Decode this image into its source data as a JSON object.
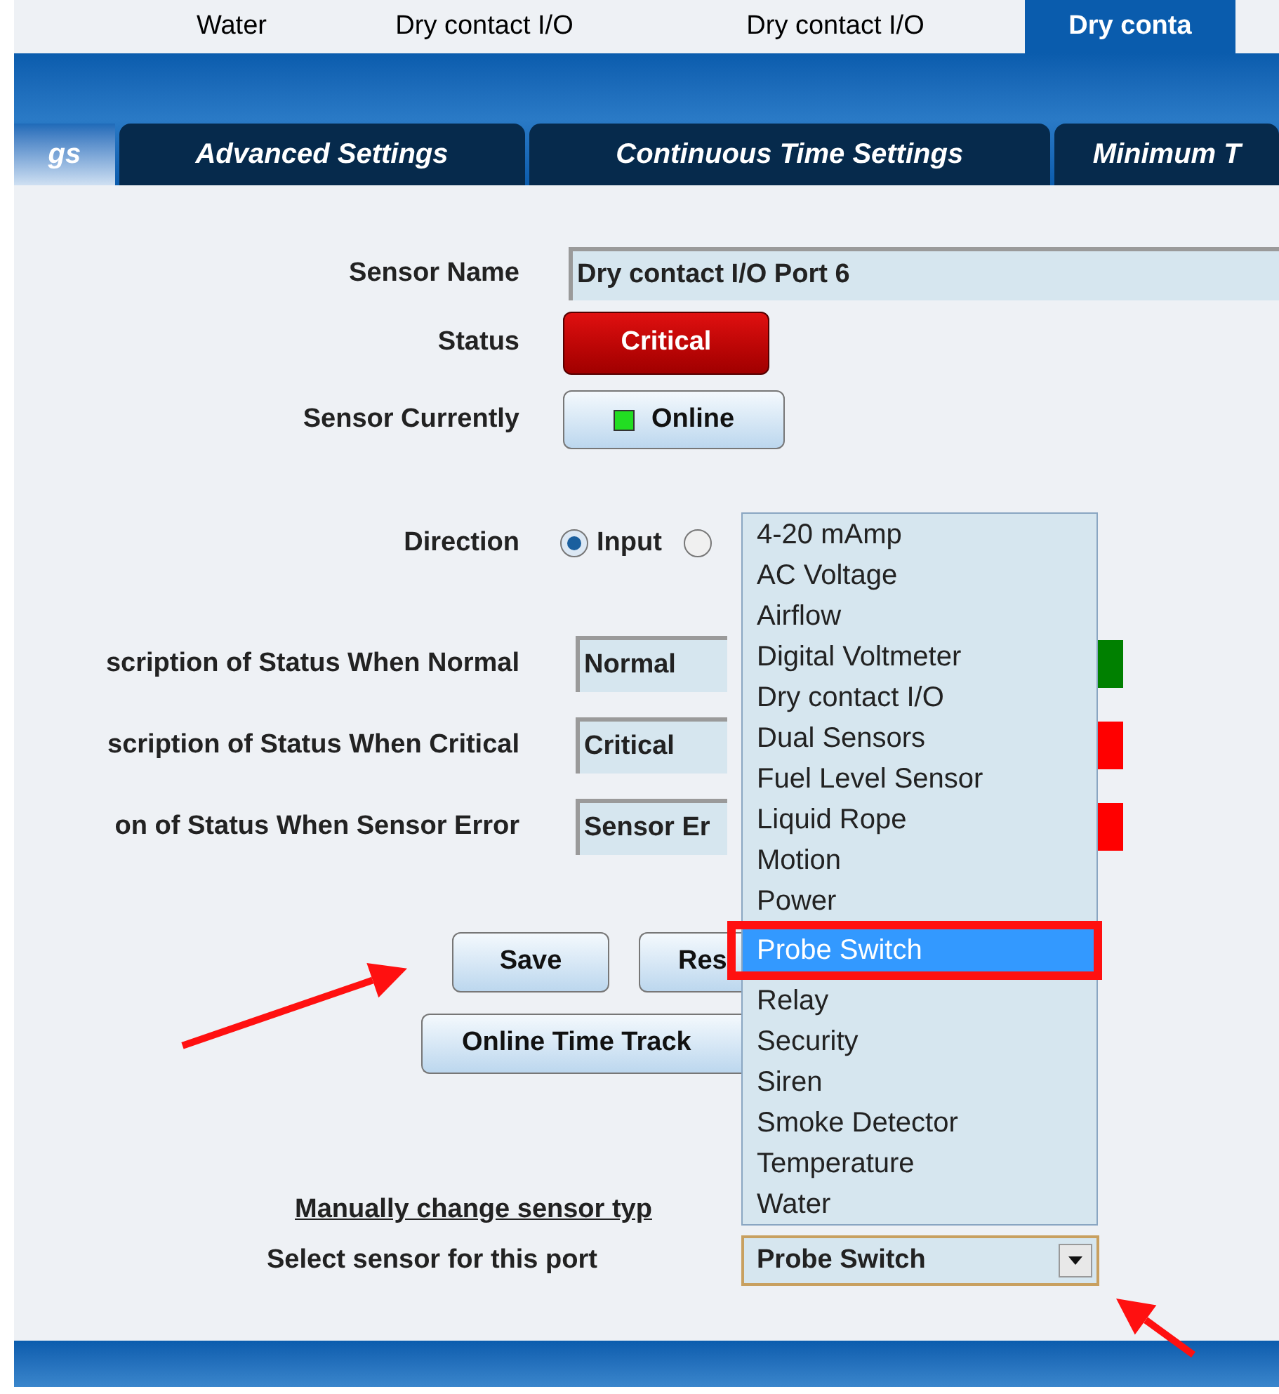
{
  "port_tabs": [
    {
      "label": "Water",
      "selected": false
    },
    {
      "label": "Dry contact I/O",
      "selected": false
    },
    {
      "label": "Dry contact I/O",
      "selected": false
    },
    {
      "label": "Dry conta",
      "selected": true
    }
  ],
  "settings_tabs": [
    {
      "label": "gs",
      "selected": true
    },
    {
      "label": "Advanced Settings",
      "selected": false
    },
    {
      "label": "Continuous Time Settings",
      "selected": false
    },
    {
      "label": "Minimum T",
      "selected": false
    }
  ],
  "sensor_name": {
    "label": "Sensor Name",
    "value": "Dry contact I/O Port 6"
  },
  "status": {
    "label": "Status",
    "value": "Critical"
  },
  "sensor_currently": {
    "label": "Sensor Currently",
    "value": "Online",
    "color": "#22dd22"
  },
  "direction": {
    "label": "Direction",
    "options": [
      {
        "label": "Input",
        "selected": true
      },
      {
        "selected": false
      }
    ]
  },
  "descriptions": [
    {
      "label": "scription of Status When Normal",
      "value": "Normal",
      "color": "#008000"
    },
    {
      "label": "scription of Status When Critical",
      "value": "Critical",
      "color": "#ff0000"
    },
    {
      "label": "on of Status When Sensor Error",
      "value": "Sensor Er",
      "color": "#ff0000"
    }
  ],
  "buttons": [
    "Save",
    "Res"
  ],
  "online_button": "Online Time Track",
  "manual_link": "Manually change sensor typ",
  "select": {
    "label": "Select sensor for this port",
    "value": "Probe Switch"
  },
  "dropdown_options": [
    {
      "label": "4-20 mAmp",
      "selected": false
    },
    {
      "label": "AC Voltage",
      "selected": false
    },
    {
      "label": "Airflow",
      "selected": false
    },
    {
      "label": "Digital Voltmeter",
      "selected": false
    },
    {
      "label": "Dry contact I/O",
      "selected": false
    },
    {
      "label": "Dual Sensors",
      "selected": false
    },
    {
      "label": "Fuel Level Sensor",
      "selected": false
    },
    {
      "label": "Liquid Rope",
      "selected": false
    },
    {
      "label": "Motion",
      "selected": false
    },
    {
      "label": "Power",
      "selected": false
    },
    {
      "label": "Probe Switch",
      "selected": true
    },
    {
      "label": "Relay",
      "selected": false
    },
    {
      "label": "Security",
      "selected": false
    },
    {
      "label": "Siren",
      "selected": false
    },
    {
      "label": "Smoke Detector",
      "selected": false
    },
    {
      "label": "Temperature",
      "selected": false
    },
    {
      "label": "Water",
      "selected": false
    }
  ],
  "annotations": [
    {
      "kind": "arrow"
    },
    {
      "kind": "highlight_box"
    },
    {
      "kind": "arrow"
    }
  ]
}
